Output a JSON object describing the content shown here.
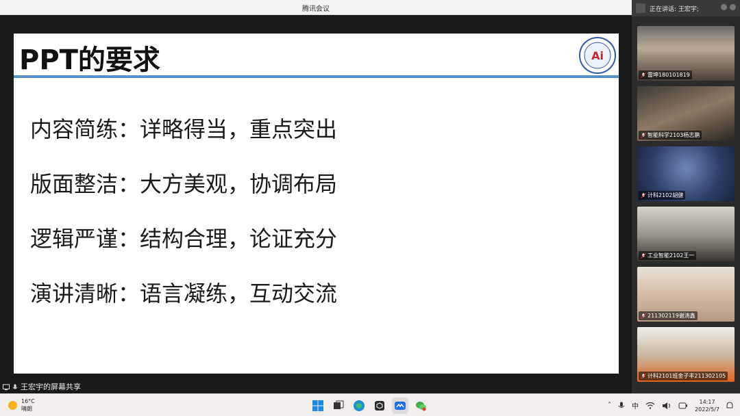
{
  "window": {
    "title": "腾讯会议"
  },
  "slide": {
    "title": "PPT的要求",
    "bullets": [
      "内容简练：详略得当，重点突出",
      "版面整洁：大方美观，协调布局",
      "逻辑严谨：结构合理，论证充分",
      "演讲清晰：语言凝练，互动交流"
    ]
  },
  "share": {
    "caption": "王宏宇的屏幕共享"
  },
  "panel": {
    "speaking_label": "正在讲话: 王宏宇;",
    "participants": [
      {
        "name": "雷坤180101819"
      },
      {
        "name": "智能科学2103杨志鹏"
      },
      {
        "name": "计科2102胡健"
      },
      {
        "name": "工业智能2102王一"
      },
      {
        "name": "211302119谢涛鑫"
      },
      {
        "name": "计科2101班金子丰211302105"
      }
    ]
  },
  "taskbar": {
    "weather_temp": "16°C",
    "weather_desc": "晴朗",
    "ime": "中",
    "time": "14:17",
    "date": "2022/5/7"
  },
  "colors": {
    "accent_line": "#5a8fc6",
    "slide_bg": "#ffffff"
  }
}
